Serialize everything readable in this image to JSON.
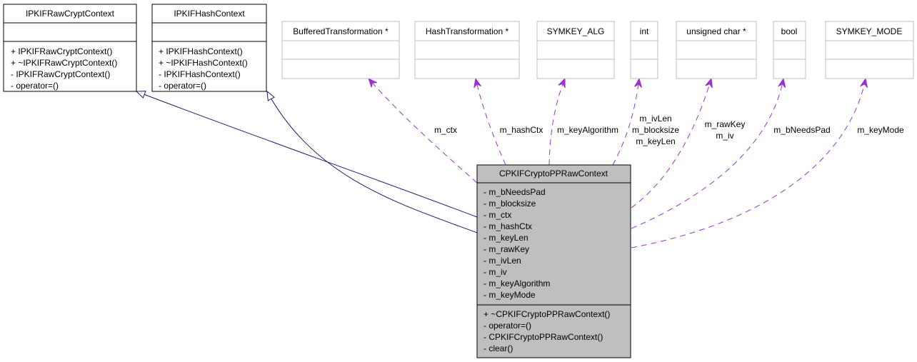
{
  "diagram": {
    "type": "collaboration-diagram",
    "classes": [
      {
        "id": "ipkif-raw-crypt-context",
        "name": "IPKIFRawCryptContext",
        "attributes": [],
        "methods": [
          "+ IPKIFRawCryptContext()",
          "+ ~IPKIFRawCryptContext()",
          "- IPKIFRawCryptContext()",
          "- operator=()"
        ],
        "border": "#000000",
        "fill": "#ffffff"
      },
      {
        "id": "ipkif-hash-context",
        "name": "IPKIFHashContext",
        "attributes": [],
        "methods": [
          "+ IPKIFHashContext()",
          "+ ~IPKIFHashContext()",
          "- IPKIFHashContext()",
          "- operator=()"
        ],
        "border": "#000000",
        "fill": "#ffffff"
      },
      {
        "id": "buffered-transformation",
        "name": "BufferedTransformation *",
        "attributes": [],
        "methods": [],
        "border": "#bfbfbf",
        "fill": "#ffffff"
      },
      {
        "id": "hash-transformation",
        "name": "HashTransformation *",
        "attributes": [],
        "methods": [],
        "border": "#bfbfbf",
        "fill": "#ffffff"
      },
      {
        "id": "symkey-alg",
        "name": "SYMKEY_ALG",
        "attributes": [],
        "methods": [],
        "border": "#bfbfbf",
        "fill": "#ffffff"
      },
      {
        "id": "int",
        "name": "int",
        "attributes": [],
        "methods": [],
        "border": "#bfbfbf",
        "fill": "#ffffff"
      },
      {
        "id": "unsigned-char-ptr",
        "name": "unsigned char *",
        "attributes": [],
        "methods": [],
        "border": "#bfbfbf",
        "fill": "#ffffff"
      },
      {
        "id": "bool",
        "name": "bool",
        "attributes": [],
        "methods": [],
        "border": "#bfbfbf",
        "fill": "#ffffff"
      },
      {
        "id": "symkey-mode",
        "name": "SYMKEY_MODE",
        "attributes": [],
        "methods": [],
        "border": "#bfbfbf",
        "fill": "#ffffff"
      },
      {
        "id": "cpkif-crypto-pp-raw-context",
        "name": "CPKIFCryptoPPRawContext",
        "attributes": [
          "- m_bNeedsPad",
          "- m_blocksize",
          "- m_ctx",
          "- m_hashCtx",
          "- m_keyLen",
          "- m_rawKey",
          "- m_ivLen",
          "- m_iv",
          "- m_keyAlgorithm",
          "- m_keyMode"
        ],
        "methods": [
          "+ ~CPKIFCryptoPPRawContext()",
          "- operator=()",
          "- CPKIFCryptoPPRawContext()",
          "- clear()"
        ],
        "border": "#000000",
        "fill": "#bfbfbf"
      }
    ],
    "inheritance_edges": [
      {
        "from": "cpkif-crypto-pp-raw-context",
        "to": "ipkif-raw-crypt-context",
        "color": "#191970"
      },
      {
        "from": "cpkif-crypto-pp-raw-context",
        "to": "ipkif-hash-context",
        "color": "#191970"
      }
    ],
    "usage_edges": [
      {
        "from": "cpkif-crypto-pp-raw-context",
        "to": "buffered-transformation",
        "labels": [
          "m_ctx"
        ],
        "color": "#9a32cd"
      },
      {
        "from": "cpkif-crypto-pp-raw-context",
        "to": "hash-transformation",
        "labels": [
          "m_hashCtx"
        ],
        "color": "#9a32cd"
      },
      {
        "from": "cpkif-crypto-pp-raw-context",
        "to": "symkey-alg",
        "labels": [
          "m_keyAlgorithm"
        ],
        "color": "#9a32cd"
      },
      {
        "from": "cpkif-crypto-pp-raw-context",
        "to": "int",
        "labels": [
          "m_ivLen",
          "m_blocksize",
          "m_keyLen"
        ],
        "color": "#9a32cd"
      },
      {
        "from": "cpkif-crypto-pp-raw-context",
        "to": "unsigned-char-ptr",
        "labels": [
          "m_rawKey",
          "m_iv"
        ],
        "color": "#9a32cd"
      },
      {
        "from": "cpkif-crypto-pp-raw-context",
        "to": "bool",
        "labels": [
          "m_bNeedsPad"
        ],
        "color": "#9a32cd"
      },
      {
        "from": "cpkif-crypto-pp-raw-context",
        "to": "symkey-mode",
        "labels": [
          "m_keyMode"
        ],
        "color": "#9a32cd"
      }
    ]
  }
}
